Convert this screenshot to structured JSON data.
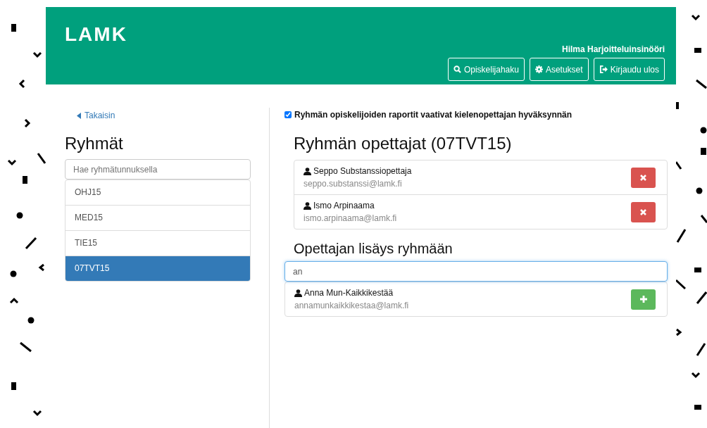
{
  "header": {
    "logo": "LAMK",
    "user": "Hilma Harjoitteluinsinööri",
    "buttons": [
      {
        "kind": "search",
        "label": "Opiskelijahaku"
      },
      {
        "kind": "settings",
        "label": "Asetukset"
      },
      {
        "kind": "logout",
        "label": "Kirjaudu ulos"
      }
    ]
  },
  "back_link": "Takaisin",
  "groups": {
    "title": "Ryhmät",
    "search": {
      "placeholder": "Hae ryhmätunnuksella"
    },
    "items": [
      {
        "label": "OHJ15",
        "selected": false
      },
      {
        "label": "MED15",
        "selected": false
      },
      {
        "label": "TIE15",
        "selected": false
      },
      {
        "label": "07TVT15",
        "selected": true
      }
    ]
  },
  "approval": {
    "checked": true,
    "label": "Ryhmän opiskelijoiden raportit vaativat kielenopettajan hyväksynnän"
  },
  "teachers": {
    "title": "Ryhmän opettajat (07TVT15)",
    "items": [
      {
        "name": "Seppo Substanssiopettaja",
        "email": "seppo.substanssi@lamk.fi"
      },
      {
        "name": "Ismo Arpinaama",
        "email": "ismo.arpinaama@lamk.fi"
      }
    ]
  },
  "add": {
    "title": "Opettajan lisäys ryhmään",
    "search": {
      "value": "an"
    },
    "results": [
      {
        "name": "Anna Mun-Kaikkikestää",
        "email": "annamunkaikkikestaa@lamk.fi"
      }
    ]
  }
}
